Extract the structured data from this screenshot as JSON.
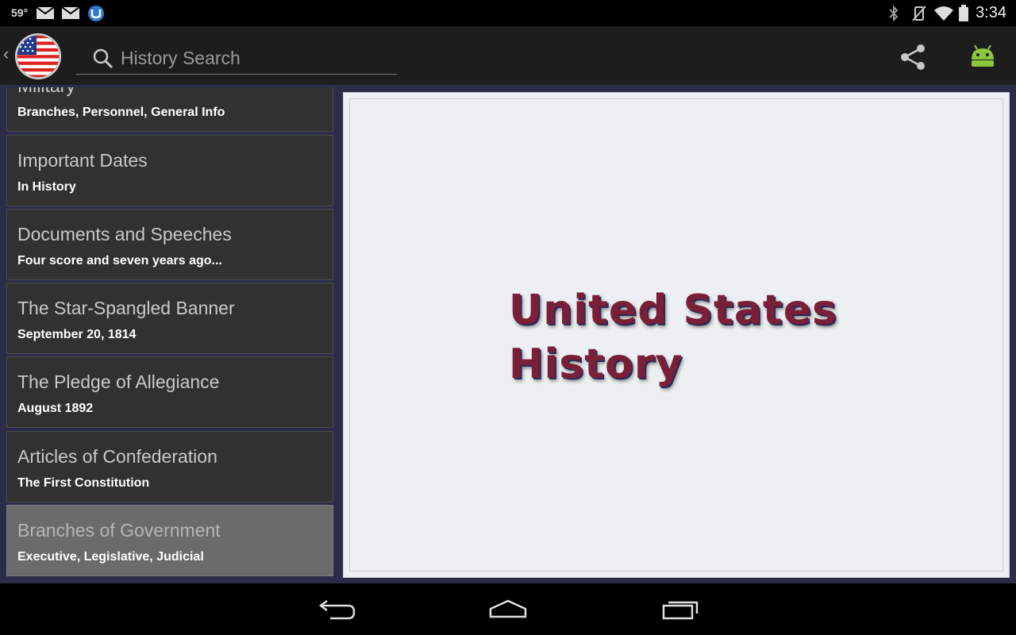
{
  "status_bar": {
    "temperature": "59°",
    "clock": "3:34",
    "icons": [
      "gmail-icon",
      "gmail-icon",
      "app-notification-icon",
      "bluetooth-icon",
      "vibrate-icon",
      "wifi-icon",
      "battery-icon"
    ]
  },
  "action_bar": {
    "app_icon": "us-flag-icon",
    "search": {
      "placeholder": "History Search",
      "value": ""
    },
    "actions": [
      "share-icon",
      "android-icon"
    ]
  },
  "sidebar": {
    "items": [
      {
        "title": "Military",
        "subtitle": "Branches, Personnel, General Info",
        "selected": false
      },
      {
        "title": "Important Dates",
        "subtitle": "In History",
        "selected": false
      },
      {
        "title": "Documents and Speeches",
        "subtitle": "Four score and seven years ago...",
        "selected": false
      },
      {
        "title": "The Star-Spangled Banner",
        "subtitle": "September 20, 1814",
        "selected": false
      },
      {
        "title": "The Pledge of Allegiance",
        "subtitle": "August 1892",
        "selected": false
      },
      {
        "title": "Articles of Confederation",
        "subtitle": "The First Constitution",
        "selected": false
      },
      {
        "title": "Branches of Government",
        "subtitle": "Executive, Legislative, Judicial",
        "selected": true
      }
    ]
  },
  "detail": {
    "title_line1": "United States",
    "title_line2": "History",
    "title_color": "#7a1f37"
  },
  "nav_bar": {
    "buttons": [
      "back-icon",
      "home-icon",
      "recent-apps-icon"
    ]
  }
}
